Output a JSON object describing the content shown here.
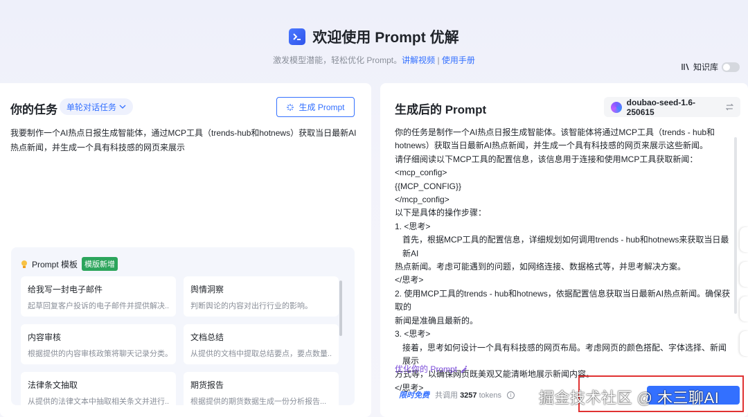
{
  "header": {
    "title": "欢迎使用 Prompt 优解",
    "subtitle_prefix": "激发模型潜能，轻松优化 Prompt。",
    "link_video": "讲解视频",
    "separator": " | ",
    "link_manual": "使用手册",
    "knowledge_base_label": "知识库",
    "knowledge_base_enabled": false
  },
  "left": {
    "title": "你的任务",
    "task_type": "单轮对话任务",
    "generate_button": "生成 Prompt",
    "task_text": "我要制作一个AI热点日报生成智能体，通过MCP工具（trends-hub和hotnews）获取当日最新AI热点新闻，并生成一个具有科技感的网页来展示",
    "templates": {
      "title": "Prompt 模板",
      "badge": "模版新增",
      "items": [
        {
          "title": "给我写一封电子邮件",
          "desc": "起草回复客户投诉的电子邮件并提供解决..."
        },
        {
          "title": "舆情洞察",
          "desc": "判断舆论的内容对出行行业的影响。"
        },
        {
          "title": "内容审核",
          "desc": "根据提供的内容审核政策将聊天记录分类。"
        },
        {
          "title": "文档总结",
          "desc": "从提供的文档中提取总结要点，要点数量..."
        },
        {
          "title": "法律条文抽取",
          "desc": "从提供的法律文本中抽取相关条文并进行..."
        },
        {
          "title": "期货报告",
          "desc": "根据提供的期货数据生成一份分析报告..."
        }
      ]
    }
  },
  "right": {
    "title": "生成后的 Prompt",
    "model": "doubao-seed-1.6-250615",
    "lines": [
      "你的任务是制作一个AI热点日报生成智能体。该智能体将通过MCP工具（trends - hub和",
      "hotnews）获取当日最新AI热点新闻，并生成一个具有科技感的网页来展示这些新闻。",
      "请仔细阅读以下MCP工具的配置信息，该信息用于连接和使用MCP工具获取新闻：",
      "<mcp_config>",
      "{{MCP_CONFIG}}",
      "</mcp_config>",
      "以下是具体的操作步骤：",
      "1. <思考>",
      "首先，根据MCP工具的配置信息，详细规划如何调用trends - hub和hotnews来获取当日最新AI",
      "热点新闻。考虑可能遇到的问题，如网络连接、数据格式等，并思考解决方案。",
      "</思考>",
      "2. 使用MCP工具的trends - hub和hotnews，依据配置信息获取当日最新AI热点新闻。确保获取的",
      "新闻是准确且最新的。",
      "3. <思考>",
      "接着，思考如何设计一个具有科技感的网页布局。考虑网页的颜色搭配、字体选择、新闻展示",
      "方式等，以确保网页既美观又能清晰地展示新闻内容。",
      "</思考>"
    ],
    "optimize_label": "优化你的 Prompt",
    "free_label": "限时免费",
    "usage_prefix": "共调用",
    "usage_tokens": "3257",
    "usage_suffix": "tokens"
  },
  "watermark": "掘金技术社区 @ 木三聊AI",
  "colors": {
    "accent": "#3370ff",
    "highlight_border": "#e03131",
    "badge_green": "#2ca55c"
  }
}
